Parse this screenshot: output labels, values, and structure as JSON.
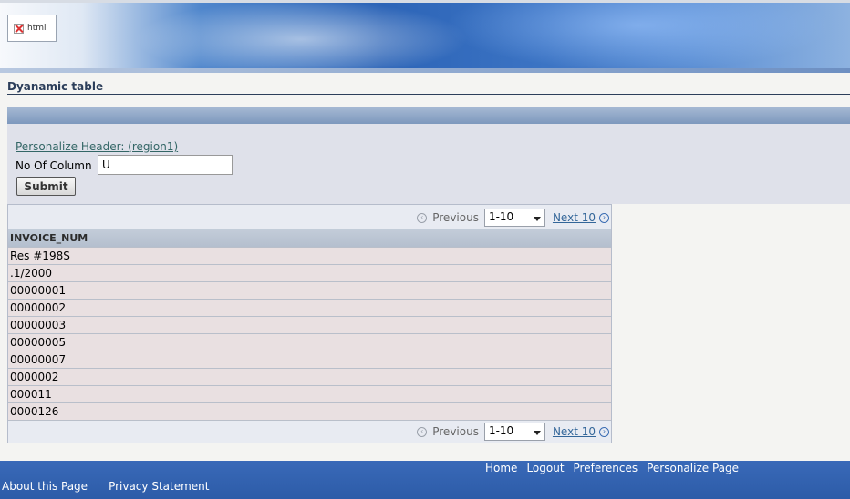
{
  "header": {
    "logo_alt": "html"
  },
  "page": {
    "title": "Dyanamic table"
  },
  "form": {
    "personalize_link": "Personalize Header: (region1)",
    "column_label": "No Of Column",
    "column_value": "U",
    "submit_label": "Submit"
  },
  "table": {
    "nav": {
      "previous_label": "Previous",
      "range_value": "1-10",
      "next_label": "Next 10"
    },
    "columns": [
      "INVOICE_NUM"
    ],
    "rows": [
      "Res #198S",
      ".1/2000",
      "00000001",
      "00000002",
      "00000003",
      "00000005",
      "00000007",
      "0000002",
      "000011",
      "0000126"
    ]
  },
  "footer": {
    "global_links": [
      "Home",
      "Logout",
      "Preferences",
      "Personalize Page"
    ],
    "page_links": [
      "About this Page",
      "Privacy Statement"
    ]
  },
  "colors": {
    "brand_blue": "#2d5ca8",
    "link_teal": "#336666",
    "link_blue": "#336699"
  }
}
